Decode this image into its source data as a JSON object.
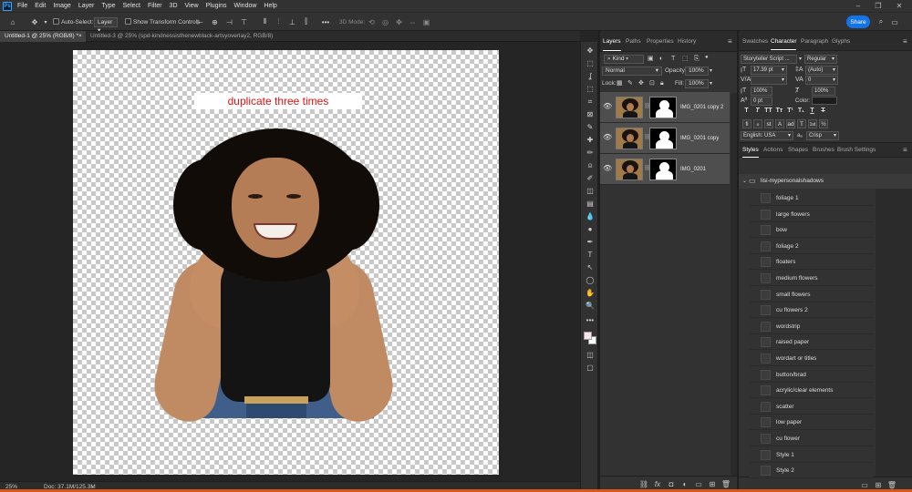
{
  "app": {
    "logo": "Ps"
  },
  "menubar": {
    "items": [
      "File",
      "Edit",
      "Image",
      "Layer",
      "Type",
      "Select",
      "Filter",
      "3D",
      "View",
      "Plugins",
      "Window",
      "Help"
    ],
    "window_controls": [
      "–",
      "❐",
      "✕"
    ]
  },
  "options": {
    "auto_select_label": "Auto-Select:",
    "auto_select_target": "Layer",
    "show_transform_label": "Show Transform Controls",
    "mode_3d_label": "3D Mode:",
    "share_label": "Share"
  },
  "tabs": [
    {
      "label": "Untitled-1 @ 25% (RGB/8) *",
      "close": "×"
    },
    {
      "label": "Untitled-3 @ 25% (spd-kindnessisthenewblack-artsyoverlay2, RGB/8) *",
      "close": "×"
    }
  ],
  "canvas": {
    "note_text": "duplicate three times",
    "note_color": "#e01010"
  },
  "status": {
    "zoom": "25%",
    "doc": "Doc: 37.1M/125.3M"
  },
  "toolbar": {
    "tools": [
      "move-tool",
      "marquee-tool",
      "lasso-tool",
      "object-select-tool",
      "crop-tool",
      "frame-tool",
      "eyedropper-tool",
      "healing-tool",
      "brush-tool",
      "stamp-tool",
      "history-brush-tool",
      "eraser-tool",
      "gradient-tool",
      "blur-tool",
      "dodge-tool",
      "pen-tool",
      "type-tool",
      "path-select-tool",
      "shape-tool",
      "hand-tool",
      "zoom-tool",
      "more-tools"
    ],
    "glyphs": [
      "✥",
      "⬚",
      "ʆ",
      "⬚",
      "⌗",
      "⊠",
      "✎",
      "✚",
      "✏",
      "⍝",
      "✐",
      "◫",
      "▤",
      "💧",
      "●",
      "✒",
      "T",
      "↖",
      "◯",
      "✋",
      "🔍",
      "•••"
    ]
  },
  "layers_panel": {
    "tabs": [
      "Layers",
      "Paths",
      "Properties",
      "History"
    ],
    "active_tab": "Layers",
    "kind_label": "Kind",
    "blend_mode": "Normal",
    "opacity_label": "Opacity:",
    "opacity_value": "100%",
    "lock_label": "Lock:",
    "fill_label": "Fill:",
    "fill_value": "100%",
    "layers": [
      {
        "name": "IMG_0201 copy 2",
        "selected": true
      },
      {
        "name": "IMG_0201 copy",
        "selected": true
      },
      {
        "name": "IMG_0201",
        "selected": true
      }
    ],
    "footer_icons": [
      "link-icon",
      "fx-icon",
      "mask-icon",
      "adjustment-icon",
      "folder-icon",
      "new-layer-icon",
      "trash-icon"
    ],
    "footer_glyphs": [
      "⛓",
      "fx",
      "◘",
      "◐",
      "▭",
      "⊞",
      "🗑"
    ]
  },
  "character_panel": {
    "tabs": [
      "Swatches",
      "Character",
      "Paragraph",
      "Glyphs"
    ],
    "active_tab": "Character",
    "font_family": "Storyteller Script ...",
    "font_style": "Regular",
    "font_size": "17.39 pt",
    "leading": "(Auto)",
    "kerning": "",
    "tracking": "0",
    "vertical_scale": "100%",
    "horizontal_scale": "100%",
    "baseline_shift": "0 pt",
    "color_label": "Color:",
    "language": "English: USA",
    "antialias_glyph": "aₐ",
    "antialias": "Crisp",
    "type_buttons": [
      "T",
      "T",
      "TT",
      "Tᴛ",
      "T¹",
      "T₁",
      "T",
      "T"
    ],
    "opentype_buttons": [
      "fi",
      "ℴ",
      "st",
      "A",
      "ad",
      "T",
      "1st",
      "½"
    ]
  },
  "styles_panel": {
    "tabs": [
      "Styles",
      "Actions",
      "Shapes",
      "Brushes",
      "Brush Settings"
    ],
    "active_tab": "Styles",
    "folder_name": "lisi-mypersonalshadows",
    "items": [
      "foliage 1",
      "large flowers",
      "bow",
      "foliage 2",
      "floaters",
      "medium flowers",
      "small flowers",
      "cu flowers 2",
      "wordstrip",
      "raised paper",
      "wordart or titles",
      "button/brad",
      "acrylic/clear elements",
      "scatter",
      "low paper",
      "cu flower",
      "Style 1",
      "Style 2"
    ]
  }
}
